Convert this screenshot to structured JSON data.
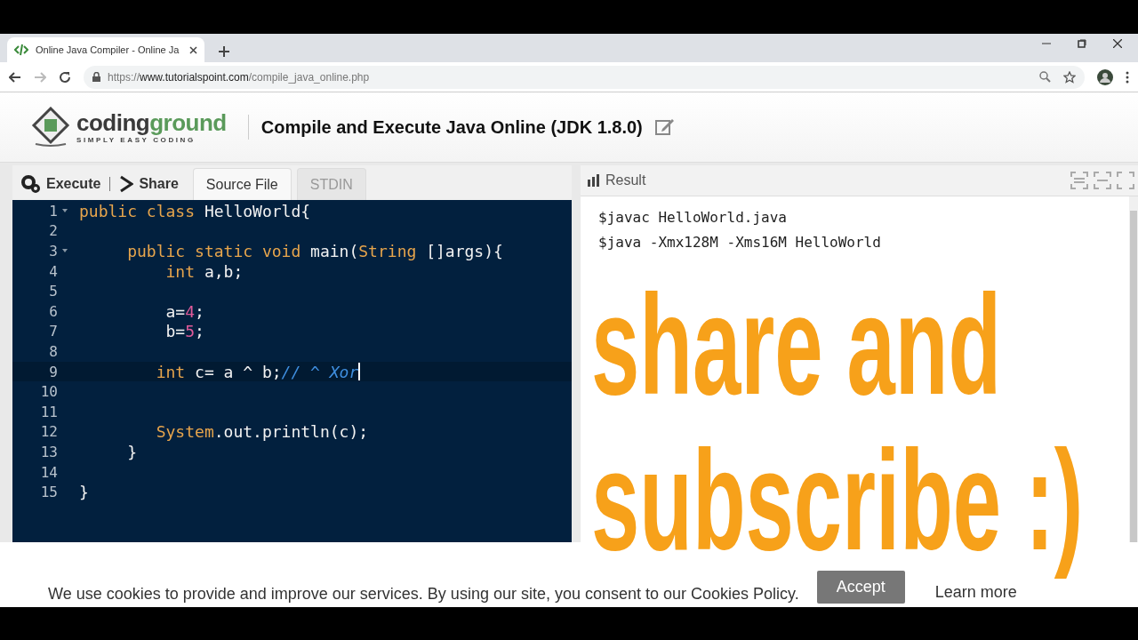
{
  "browser": {
    "tab_title": "Online Java Compiler - Online Ja",
    "url": {
      "scheme": "https://",
      "host": "www.tutorialspoint.com",
      "path": "/compile_java_online.php"
    }
  },
  "header": {
    "logo": {
      "first": "coding",
      "second": "ground",
      "tagline": "SIMPLY EASY CODING"
    },
    "title": "Compile and Execute Java Online (JDK 1.8.0)"
  },
  "toolbar": {
    "actions": [
      {
        "label": "Execute",
        "kind": "execute"
      },
      {
        "label": "Share",
        "kind": "share"
      }
    ],
    "tabs": [
      {
        "label": "Source File",
        "selected": true
      },
      {
        "label": "STDIN",
        "selected": false
      }
    ]
  },
  "editor": {
    "lines": [
      {
        "number": "1",
        "foldable": true,
        "current": false,
        "tokens": [
          {
            "text": "public class",
            "kind": "keyword"
          },
          {
            "text": " HelloWorld{",
            "kind": "plain"
          }
        ]
      },
      {
        "number": "2",
        "foldable": false,
        "current": false
      },
      {
        "number": "3",
        "foldable": true,
        "current": false,
        "tokens": [
          {
            "text": "     public static void",
            "kind": "keyword"
          },
          {
            "text": " main(",
            "kind": "plain"
          },
          {
            "text": "String",
            "kind": "keyword"
          },
          {
            "text": " []args){",
            "kind": "plain"
          }
        ]
      },
      {
        "number": "4",
        "foldable": false,
        "current": false,
        "tokens": [
          {
            "text": "         int",
            "kind": "keyword"
          },
          {
            "text": " a,b;",
            "kind": "plain"
          }
        ]
      },
      {
        "number": "5",
        "foldable": false,
        "current": false
      },
      {
        "number": "6",
        "foldable": false,
        "current": false,
        "tokens": [
          {
            "text": "         a=",
            "kind": "plain"
          },
          {
            "text": "4",
            "kind": "number"
          },
          {
            "text": ";",
            "kind": "plain"
          }
        ]
      },
      {
        "number": "7",
        "foldable": false,
        "current": false,
        "tokens": [
          {
            "text": "         b=",
            "kind": "plain"
          },
          {
            "text": "5",
            "kind": "number"
          },
          {
            "text": ";",
            "kind": "plain"
          }
        ]
      },
      {
        "number": "8",
        "foldable": false,
        "current": false
      },
      {
        "number": "9",
        "foldable": false,
        "current": true,
        "tokens": [
          {
            "text": "        int",
            "kind": "keyword"
          },
          {
            "text": " c= a ^ b;",
            "kind": "plain"
          },
          {
            "text": "// ^ Xor",
            "kind": "comment"
          }
        ]
      },
      {
        "number": "10",
        "foldable": false,
        "current": false
      },
      {
        "number": "11",
        "foldable": false,
        "current": false
      },
      {
        "number": "12",
        "foldable": false,
        "current": false,
        "tokens": [
          {
            "text": "        System",
            "kind": "keyword"
          },
          {
            "text": ".out.println(c);",
            "kind": "plain"
          }
        ]
      },
      {
        "number": "13",
        "foldable": false,
        "current": false,
        "tokens": [
          {
            "text": "     }",
            "kind": "plain"
          }
        ]
      },
      {
        "number": "14",
        "foldable": false,
        "current": false
      },
      {
        "number": "15",
        "foldable": false,
        "current": false,
        "tokens": [
          {
            "text": "}",
            "kind": "plain"
          }
        ]
      }
    ]
  },
  "result": {
    "title": "Result",
    "lines": [
      "$javac HelloWorld.java",
      "$java -Xmx128M -Xms16M HelloWorld"
    ]
  },
  "overlay_caption": [
    "share and",
    "subscribe :)"
  ],
  "cookie_bar": {
    "message": "We use cookies to provide and improve our services. By using our site, you consent to our Cookies Policy.",
    "accept": "Accept",
    "learn_more": "Learn more"
  }
}
